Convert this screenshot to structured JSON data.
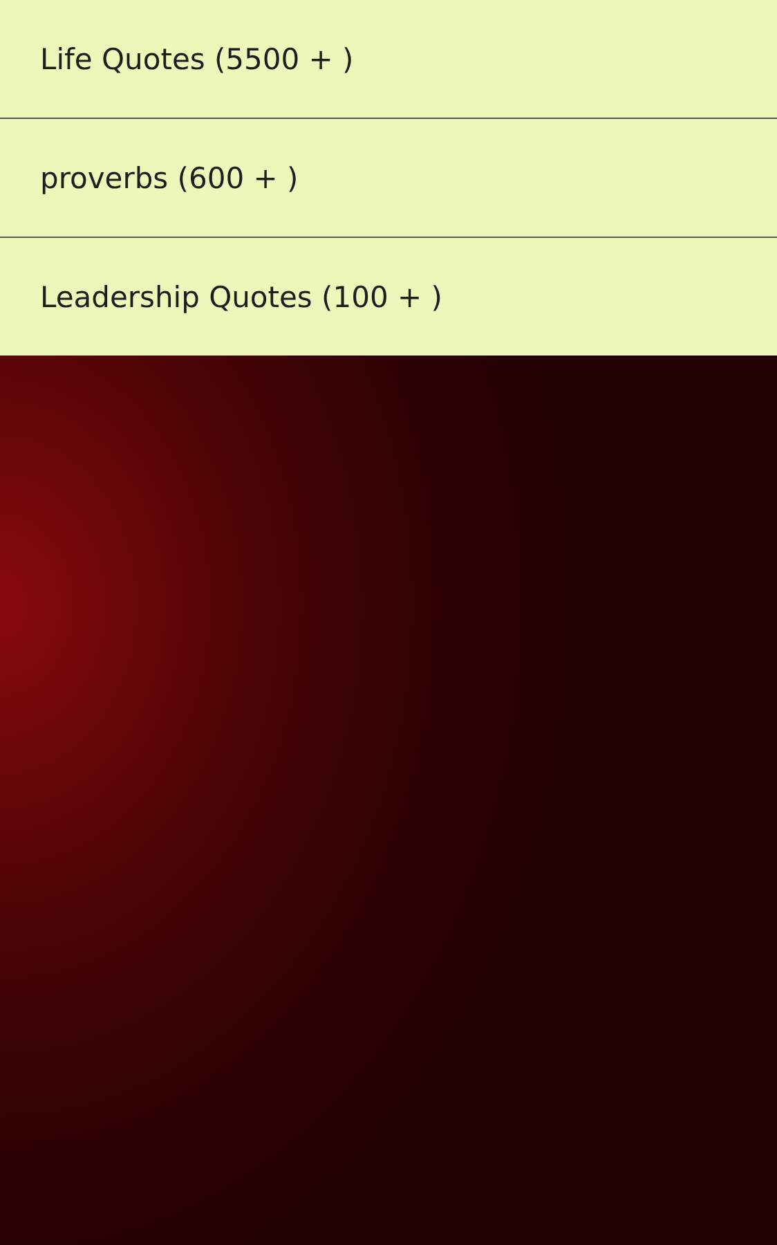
{
  "menu": {
    "items": [
      {
        "label": "Life Quotes (5500 + )"
      },
      {
        "label": "proverbs (600 + )"
      },
      {
        "label": "Leadership Quotes (100 + )"
      }
    ]
  }
}
